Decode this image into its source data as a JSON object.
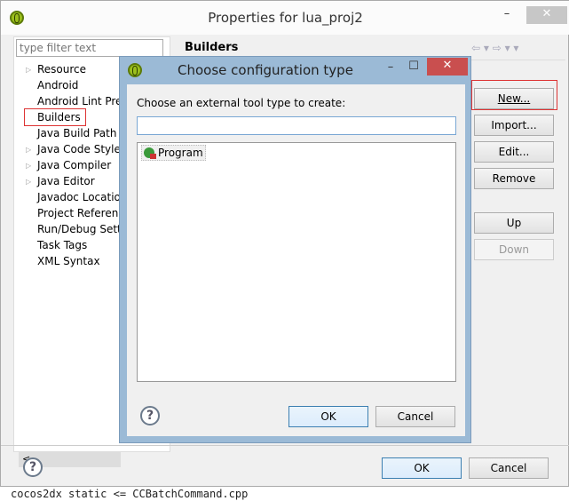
{
  "window": {
    "title": "Properties for lua_proj2",
    "minimize": "–",
    "maximize": "☐",
    "close": "✕"
  },
  "filter": {
    "placeholder": "type filter text"
  },
  "tree": [
    {
      "label": "Resource",
      "expandable": true
    },
    {
      "label": "Android",
      "expandable": false
    },
    {
      "label": "Android Lint Pre",
      "expandable": false
    },
    {
      "label": "Builders",
      "expandable": false,
      "selected": true
    },
    {
      "label": "Java Build Path",
      "expandable": false
    },
    {
      "label": "Java Code Style",
      "expandable": true
    },
    {
      "label": "Java Compiler",
      "expandable": true
    },
    {
      "label": "Java Editor",
      "expandable": true
    },
    {
      "label": "Javadoc Locatio",
      "expandable": false
    },
    {
      "label": "Project Referenc",
      "expandable": false
    },
    {
      "label": "Run/Debug Setti",
      "expandable": false
    },
    {
      "label": "Task Tags",
      "expandable": false
    },
    {
      "label": "XML Syntax",
      "expandable": false
    }
  ],
  "page": {
    "title": "Builders",
    "nav": "⇦ ▾ ⇨ ▾ ▾"
  },
  "buttons": {
    "new": "New...",
    "import": "Import...",
    "edit": "Edit...",
    "remove": "Remove",
    "up": "Up",
    "down": "Down",
    "ok": "OK",
    "cancel": "Cancel",
    "scroll_left": "<"
  },
  "dialog": {
    "title": "Choose configuration type",
    "prompt": "Choose an external tool type to create:",
    "search_value": "",
    "items": [
      "Program"
    ],
    "ok": "OK",
    "cancel": "Cancel",
    "minimize": "–",
    "maximize": "☐",
    "close": "✕"
  },
  "help": "?",
  "background_text": "cocos2dx static <= CCBatchCommand.cpp"
}
